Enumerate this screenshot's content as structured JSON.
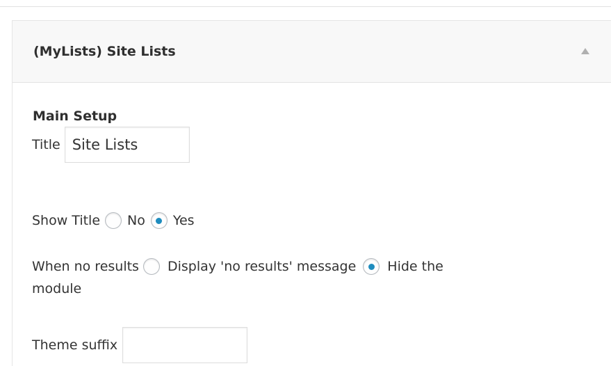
{
  "panel": {
    "title": "(MyLists) Site Lists"
  },
  "main_setup": {
    "heading": "Main Setup",
    "title_field": {
      "label": "Title",
      "value": "Site Lists"
    },
    "show_title": {
      "label": "Show Title",
      "options": [
        {
          "label": "No",
          "checked": false
        },
        {
          "label": "Yes",
          "checked": true
        }
      ]
    },
    "no_results": {
      "label": "When no results",
      "options": [
        {
          "label": "Display 'no results' message",
          "checked": false
        },
        {
          "label": "Hide the",
          "checked": true
        }
      ],
      "continuation": "module"
    },
    "theme_suffix": {
      "label": "Theme suffix",
      "value": ""
    }
  },
  "colors": {
    "accent": "#1e8cbe",
    "header_bg": "#f8f8f8",
    "border": "#e5e5e5"
  },
  "icons": {
    "toggle": "triangle-up-icon"
  }
}
